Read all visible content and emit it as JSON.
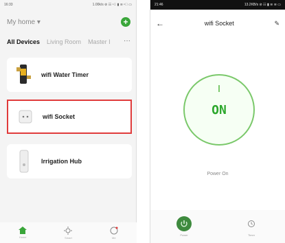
{
  "left": {
    "status": {
      "time": "16:33",
      "indicators": "1.00k/s ⊘ ☷ ⁿ⃝ ▮ ≋ ⁿ⃝ ▭"
    },
    "home_title": "My home ▾",
    "add_label": "+",
    "tabs": [
      "All Devices",
      "Living Room",
      "Master I"
    ],
    "tab_more": "···",
    "devices": [
      {
        "label": "wifi Water Timer",
        "icon": "water-timer-icon"
      },
      {
        "label": "wifi Socket",
        "icon": "socket-icon"
      },
      {
        "label": "Irrigation Hub",
        "icon": "hub-icon"
      }
    ],
    "nav": [
      {
        "label": "Home",
        "icon": "home-icon"
      },
      {
        "label": "Smart",
        "icon": "smart-icon"
      },
      {
        "label": "Me",
        "icon": "profile-icon"
      }
    ]
  },
  "right": {
    "status": {
      "time": "21:46",
      "indicators": "13.2KB/s ⊘ ☷ ▮ ≋ ≋ ▭"
    },
    "title": "wifi Socket",
    "on_label": "ON",
    "power_status": "Power On",
    "actions": [
      {
        "label": "Power",
        "icon": "power-icon"
      },
      {
        "label": "Timer",
        "icon": "timer-icon"
      }
    ]
  },
  "colors": {
    "accent_green": "#3aa63a",
    "ring_green": "#7ac86a",
    "highlight_red": "#e03a3a"
  }
}
